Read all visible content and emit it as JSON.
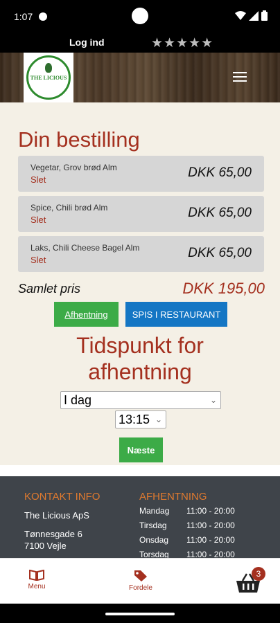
{
  "status_bar": {
    "time": "1:07"
  },
  "top_bar": {
    "login_label": "Log ind",
    "stars": "★★★★★"
  },
  "logo": {
    "text": "THE LICIOUS"
  },
  "page_title": "Din bestilling",
  "order": {
    "items": [
      {
        "name": "Vegetar, Grov brød Alm",
        "delete_label": "Slet",
        "price": "DKK 65,00"
      },
      {
        "name": "Spice, Chili brød Alm",
        "delete_label": "Slet",
        "price": "DKK 65,00"
      },
      {
        "name": "Laks, Chili Cheese Bagel Alm",
        "delete_label": "Slet",
        "price": "DKK 65,00"
      }
    ],
    "total_label": "Samlet pris",
    "total_value": "DKK 195,00"
  },
  "mode_buttons": {
    "pickup": "Afhentning",
    "dine_in": "SPIS I RESTAURANT"
  },
  "time_section": {
    "title_line1": "Tidspunkt for",
    "title_line2": "afhentning",
    "day_value": "I dag",
    "time_value": "13:15",
    "next_label": "Næste"
  },
  "footer": {
    "contact_heading": "KONTAKT INFO",
    "company": "The Licious ApS",
    "street": "Tønnesgade 6",
    "city": "7100 Vejle",
    "pickup_heading": "AFHENTNING",
    "hours": [
      {
        "day": "Mandag",
        "time": "11:00 - 20:00"
      },
      {
        "day": "Tirsdag",
        "time": "11:00 - 20:00"
      },
      {
        "day": "Onsdag",
        "time": "11:00 - 20:00"
      },
      {
        "day": "Torsdag",
        "time": "11:00 - 20:00"
      }
    ]
  },
  "bottom_nav": {
    "menu_label": "Menu",
    "fordele_label": "Fordele",
    "cart_count": "3"
  },
  "colors": {
    "accent": "#a4301f",
    "green": "#3cab47",
    "blue": "#1476c4",
    "footer_bg": "#3f444a",
    "footer_heading": "#e07a2f",
    "page_bg": "#f4f0e6"
  }
}
